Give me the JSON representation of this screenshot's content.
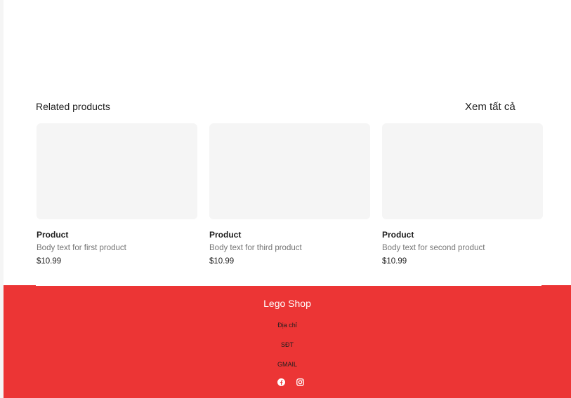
{
  "related": {
    "title": "Related products",
    "view_all": "Xem tất cả",
    "products": [
      {
        "name": "Product",
        "body": "Body text for first product",
        "price": "$10.99"
      },
      {
        "name": "Product",
        "body": "Body text for third product",
        "price": "$10.99"
      },
      {
        "name": "Product",
        "body": "Body text for second product",
        "price": "$10.99"
      }
    ]
  },
  "footer": {
    "brand": "Lego Shop",
    "address": "Địa chỉ",
    "phone": "SĐT",
    "email": "GMAIL",
    "social_icons": [
      "facebook-icon",
      "instagram-icon"
    ],
    "background_color": "#ec3535"
  }
}
